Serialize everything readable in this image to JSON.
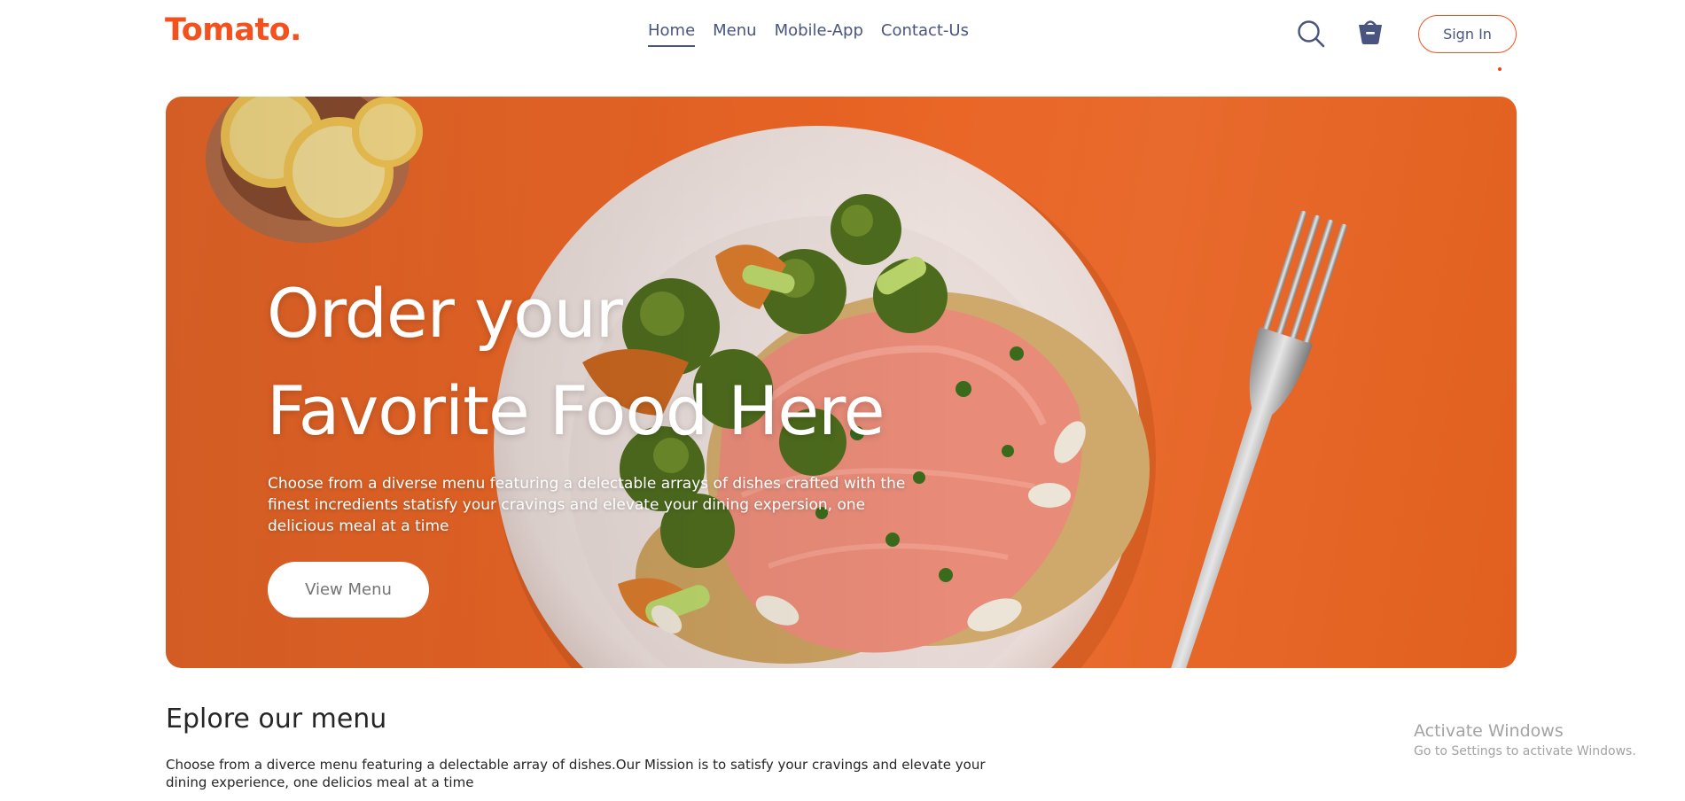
{
  "navbar": {
    "logo": "Tomato.",
    "menu": [
      {
        "label": "Home",
        "active": true
      },
      {
        "label": "Menu",
        "active": false
      },
      {
        "label": "Mobile-App",
        "active": false
      },
      {
        "label": "Contact-Us",
        "active": false
      }
    ],
    "icons": [
      "search-icon",
      "basket-icon"
    ],
    "sign_in_label": "Sign In"
  },
  "hero": {
    "title_line1": "Order your",
    "title_line2": "Favorite Food Here",
    "description": "Choose from a diverse menu featuring a delectable arrays of dishes crafted with the finest incredients statisfy your cravings and elevate your dining expersion, one delicious meal at a time",
    "button_label": "View Menu"
  },
  "explore": {
    "heading": "Eplore our menu",
    "text": "Choose from a diverce menu featuring a delectable array of dishes.Our Mission is to satisfy your cravings and elevate your dining experience, one delicios meal at a time"
  },
  "watermark": {
    "title": "Activate Windows",
    "subtitle": "Go to Settings to activate Windows."
  },
  "colors": {
    "brand": "#f4511e",
    "nav_text": "#49557e",
    "hero_background": "#ea6424"
  }
}
